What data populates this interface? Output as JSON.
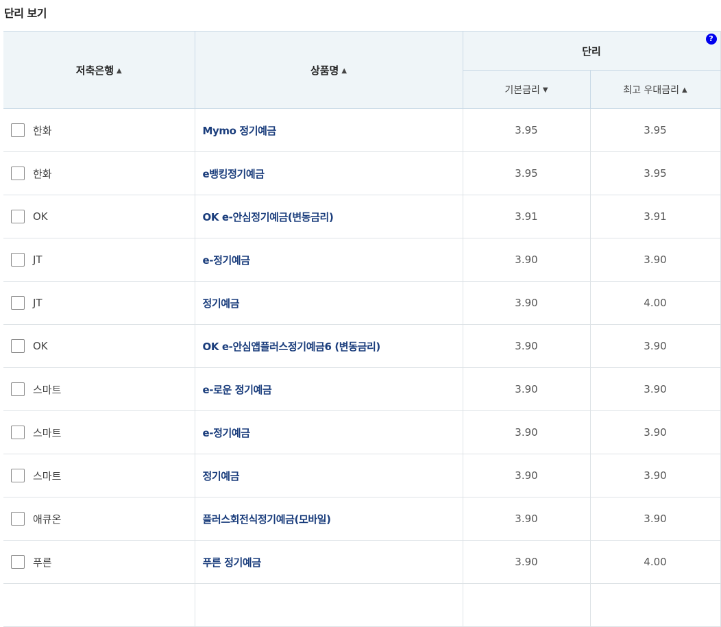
{
  "page_title": "단리 보기",
  "headers": {
    "bank": "저축은행",
    "product": "상품명",
    "group": "단리",
    "base_rate": "기본금리",
    "max_rate": "최고 우대금리",
    "help": "?"
  },
  "sort_icons": {
    "up": "▲",
    "down": "▼"
  },
  "rows": [
    {
      "bank": "한화",
      "product": "Mymo 정기예금",
      "base": "3.95",
      "max": "3.95"
    },
    {
      "bank": "한화",
      "product": "e뱅킹정기예금",
      "base": "3.95",
      "max": "3.95"
    },
    {
      "bank": "OK",
      "product": "OK e-안심정기예금(변동금리)",
      "base": "3.91",
      "max": "3.91"
    },
    {
      "bank": "JT",
      "product": "e-정기예금",
      "base": "3.90",
      "max": "3.90"
    },
    {
      "bank": "JT",
      "product": "정기예금",
      "base": "3.90",
      "max": "4.00"
    },
    {
      "bank": "OK",
      "product": "OK e-안심앱플러스정기예금6 (변동금리)",
      "base": "3.90",
      "max": "3.90"
    },
    {
      "bank": "스마트",
      "product": "e-로운 정기예금",
      "base": "3.90",
      "max": "3.90"
    },
    {
      "bank": "스마트",
      "product": "e-정기예금",
      "base": "3.90",
      "max": "3.90"
    },
    {
      "bank": "스마트",
      "product": "정기예금",
      "base": "3.90",
      "max": "3.90"
    },
    {
      "bank": "애큐온",
      "product": "플러스회전식정기예금(모바일)",
      "base": "3.90",
      "max": "3.90"
    },
    {
      "bank": "푸른",
      "product": "푸른 정기예금",
      "base": "3.90",
      "max": "4.00"
    },
    {
      "bank": "",
      "product": "",
      "base": "",
      "max": ""
    }
  ],
  "colors": {
    "header_bg": "#eff5f8",
    "product_link": "#1a3d7c",
    "help_badge": "#0000ee"
  }
}
